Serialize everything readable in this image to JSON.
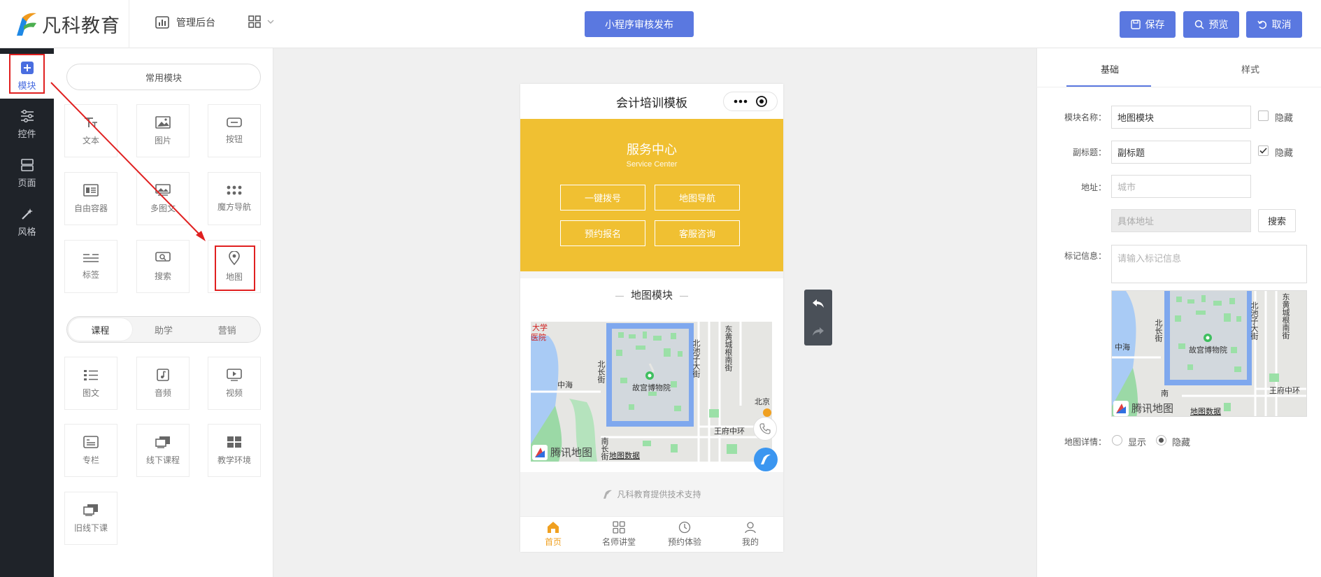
{
  "header": {
    "brand": "凡科教育",
    "admin_label": "管理后台",
    "publish_label": "小程序审核发布",
    "save_label": "保存",
    "preview_label": "预览",
    "cancel_label": "取消",
    "accent_color": "#5a78e0"
  },
  "rail": {
    "items": [
      {
        "label": "模块",
        "icon": "plus-square-icon"
      },
      {
        "label": "控件",
        "icon": "sliders-icon"
      },
      {
        "label": "页面",
        "icon": "page-layout-icon"
      },
      {
        "label": "风格",
        "icon": "magic-wand-icon"
      }
    ]
  },
  "modules": {
    "common_title": "常用模块",
    "common": [
      {
        "label": "文本",
        "icon": "text-icon"
      },
      {
        "label": "图片",
        "icon": "image-icon"
      },
      {
        "label": "按钮",
        "icon": "button-icon"
      },
      {
        "label": "自由容器",
        "icon": "container-icon"
      },
      {
        "label": "多图文",
        "icon": "multi-image-icon"
      },
      {
        "label": "魔方导航",
        "icon": "grid-nav-icon"
      },
      {
        "label": "标签",
        "icon": "tag-icon"
      },
      {
        "label": "搜索",
        "icon": "search-icon"
      },
      {
        "label": "地图",
        "icon": "map-pin-icon"
      }
    ],
    "tabs": [
      "课程",
      "助学",
      "营销"
    ],
    "course": [
      {
        "label": "图文",
        "icon": "list-icon"
      },
      {
        "label": "音频",
        "icon": "audio-icon"
      },
      {
        "label": "视频",
        "icon": "video-icon"
      },
      {
        "label": "专栏",
        "icon": "column-icon"
      },
      {
        "label": "线下课程",
        "icon": "offline-course-icon"
      },
      {
        "label": "教学环境",
        "icon": "environment-icon"
      },
      {
        "label": "旧线下课",
        "icon": "old-course-icon"
      }
    ]
  },
  "phone": {
    "title": "会计培训模板",
    "service_title": "服务中心",
    "service_subtitle": "Service Center",
    "service_buttons": [
      "一键拨号",
      "地图导航",
      "预约报名",
      "客服咨询"
    ],
    "map_title": "地图模块",
    "map": {
      "labels": [
        "大学",
        "医院",
        "中海",
        "北长街",
        "故宫博物院",
        "北池子大街",
        "东黄城根南街",
        "北京",
        "王府中环",
        "南长街"
      ],
      "attribution": "腾讯地图",
      "data_link": "地图数据"
    },
    "support_text": "凡科教育提供技术支持",
    "tabbar": [
      {
        "label": "首页",
        "icon": "home-icon",
        "active": true
      },
      {
        "label": "名师讲堂",
        "icon": "grid-icon",
        "active": false
      },
      {
        "label": "预约体验",
        "icon": "clock-icon",
        "active": false
      },
      {
        "label": "我的",
        "icon": "user-icon",
        "active": false
      }
    ],
    "yellow_color": "#f0c032"
  },
  "settings": {
    "tabs": [
      "基础",
      "样式"
    ],
    "module_name_label": "模块名称：",
    "module_name_value": "地图模块",
    "hide_label": "隐藏",
    "subtitle_label": "副标题：",
    "subtitle_value": "副标题",
    "subtitle_hidden": true,
    "address_label": "地址：",
    "city_placeholder": "城市",
    "detail_placeholder": "具体地址",
    "search_label": "搜索",
    "marker_label": "标记信息：",
    "marker_placeholder": "请输入标记信息",
    "map_detail_label": "地图详情：",
    "show_label": "显示",
    "hide_option_label": "隐藏",
    "map_labels": [
      "中海",
      "北长街",
      "故宫博物院",
      "北池子大街",
      "东黄城根南街",
      "王府中环",
      "南"
    ],
    "map_attribution": "腾讯地图",
    "map_data_link": "地图数据"
  }
}
